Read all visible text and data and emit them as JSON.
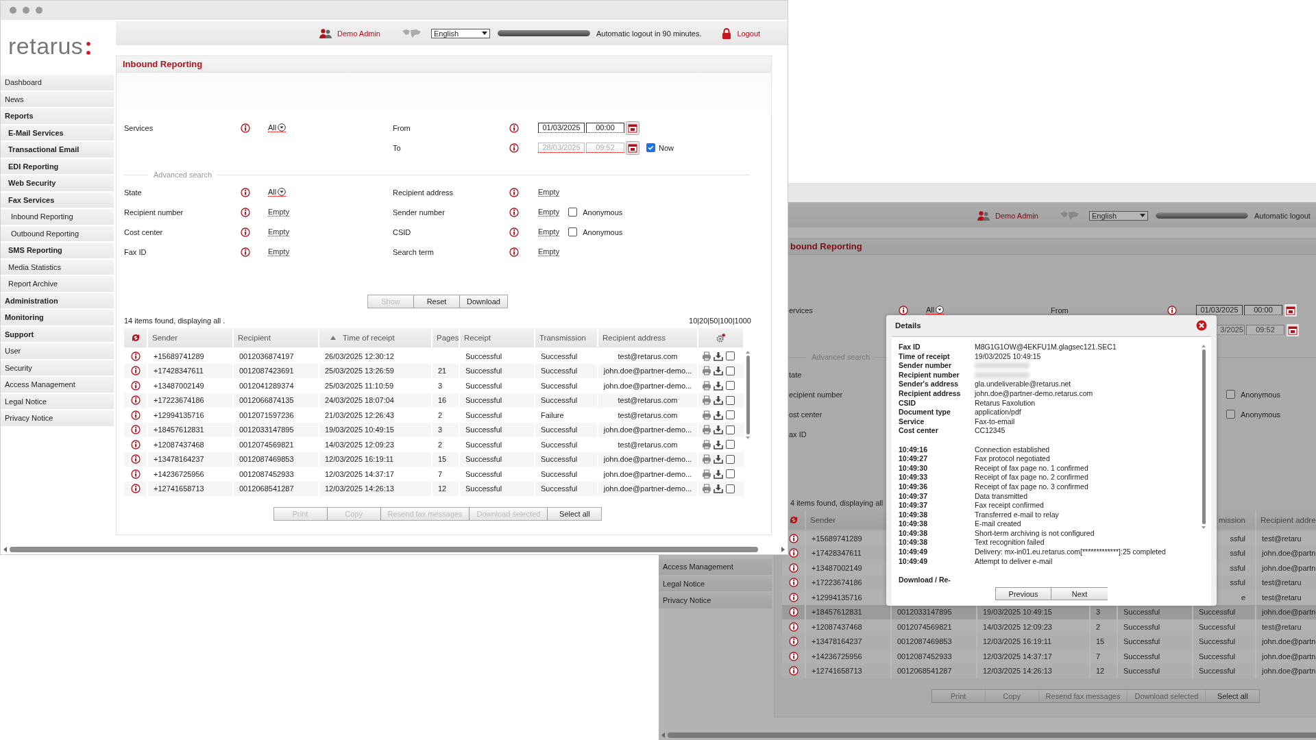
{
  "front_window": {
    "logo": "retarus",
    "header": {
      "user": "Demo Admin",
      "language": "English",
      "session_bar": {
        "level": 1
      },
      "logout_notice": "Automatic logout in 90 minutes.",
      "logout": "Logout"
    },
    "sidebar": [
      {
        "label": "Dashboard",
        "kind": "item"
      },
      {
        "label": "News",
        "kind": "item"
      },
      {
        "label": "Reports",
        "kind": "section"
      },
      {
        "label": "E-Mail Services",
        "kind": "group"
      },
      {
        "label": "Transactional Email",
        "kind": "group"
      },
      {
        "label": "EDI Reporting",
        "kind": "group"
      },
      {
        "label": "Web Security",
        "kind": "group"
      },
      {
        "label": "Fax Services",
        "kind": "group"
      },
      {
        "label": "Inbound Reporting",
        "kind": "sub"
      },
      {
        "label": "Outbound Reporting",
        "kind": "sub"
      },
      {
        "label": "SMS Reporting",
        "kind": "group"
      },
      {
        "label": "Media Statistics",
        "kind": "page"
      },
      {
        "label": "Report Archive",
        "kind": "page"
      },
      {
        "label": "Administration",
        "kind": "section"
      },
      {
        "label": "Monitoring",
        "kind": "section"
      },
      {
        "label": "Support",
        "kind": "section"
      },
      {
        "label": "User",
        "kind": "item"
      },
      {
        "label": "Security",
        "kind": "item"
      },
      {
        "label": "Access Management",
        "kind": "item"
      },
      {
        "label": "Legal Notice",
        "kind": "item"
      },
      {
        "label": "Privacy Notice",
        "kind": "item"
      }
    ],
    "page_title": "Inbound Reporting",
    "services": {
      "label": "Services",
      "value": "All"
    },
    "from": {
      "label": "From",
      "date": "01/03/2025",
      "time": "00:00",
      "disabled": false
    },
    "to": {
      "label": "To",
      "date": "28/03/2025",
      "time": "09:52",
      "disabled": true
    },
    "now": {
      "label": "Now",
      "checked": true
    },
    "advanced_title": "Advanced search",
    "fields": [
      {
        "label": "State",
        "value": "All",
        "kind": "dropdown"
      },
      {
        "label": "Recipient address",
        "value": "Empty",
        "kind": "link"
      },
      {
        "label": "Recipient number",
        "value": "Empty",
        "kind": "link"
      },
      {
        "label": "Sender number",
        "value": "Empty",
        "kind": "link",
        "anonymous": {
          "label": "Anonymous",
          "checked": false
        }
      },
      {
        "label": "Cost center",
        "value": "Empty",
        "kind": "link"
      },
      {
        "label": "CSID",
        "value": "Empty",
        "kind": "link",
        "anonymous": {
          "label": "Anonymous",
          "checked": false
        }
      },
      {
        "label": "Fax ID",
        "value": "Empty",
        "kind": "link"
      },
      {
        "label": "Search term",
        "value": "Empty",
        "kind": "link"
      }
    ],
    "buttons": [
      {
        "label": "Show",
        "disabled": true
      },
      {
        "label": "Reset",
        "disabled": false
      },
      {
        "label": "Download",
        "disabled": false
      }
    ],
    "summary": "14 items found, displaying all .",
    "page_sizes": "10|20|50|100|1000",
    "columns": [
      {
        "label": "Sender",
        "sorted": false
      },
      {
        "label": "Recipient",
        "sorted": false
      },
      {
        "label": "Time of receipt",
        "sorted": true
      },
      {
        "label": "Pages",
        "sorted": false
      },
      {
        "label": "Receipt",
        "sorted": false
      },
      {
        "label": "Transmission",
        "sorted": false
      },
      {
        "label": "Recipient address",
        "sorted": false
      }
    ],
    "rows": [
      {
        "sender": "+15689741289",
        "recipient": "0012036874197",
        "time": "26/03/2025 12:30:12",
        "receipt": "Successful",
        "transmission": "Successful",
        "address": "test@retarus.com",
        "checked": false
      },
      {
        "sender": "+17428347611",
        "recipient": "0012087423691",
        "time": "25/03/2025 13:26:59",
        "pages": "21",
        "receipt": "Successful",
        "transmission": "Successful",
        "address": "john.doe@partner-demo...",
        "checked": false
      },
      {
        "sender": "+13487002149",
        "recipient": "0012041289374",
        "time": "25/03/2025 11:10:59",
        "pages": "3",
        "receipt": "Successful",
        "transmission": "Successful",
        "address": "john.doe@partner-demo...",
        "checked": false
      },
      {
        "sender": "+17223674186",
        "recipient": "0012066874135",
        "time": "24/03/2025 18:07:04",
        "pages": "16",
        "receipt": "Successful",
        "transmission": "Successful",
        "address": "test@retarus.com",
        "checked": false
      },
      {
        "sender": "+12994135716",
        "recipient": "0012071597236",
        "time": "21/03/2025 12:26:43",
        "pages": "2",
        "receipt": "Successful",
        "transmission": "Failure",
        "address": "test@retarus.com",
        "checked": false
      },
      {
        "sender": "+18457612831",
        "recipient": "0012033147895",
        "time": "19/03/2025 10:49:15",
        "pages": "3",
        "receipt": "Successful",
        "transmission": "Successful",
        "address": "john.doe@partner-demo...",
        "checked": false
      },
      {
        "sender": "+12087437468",
        "recipient": "0012074569821",
        "time": "14/03/2025 12:09:23",
        "pages": "2",
        "receipt": "Successful",
        "transmission": "Successful",
        "address": "test@retarus.com",
        "checked": false
      },
      {
        "sender": "+13478164237",
        "recipient": "0012087469853",
        "time": "12/03/2025 16:19:11",
        "pages": "15",
        "receipt": "Successful",
        "transmission": "Successful",
        "address": "john.doe@partner-demo...",
        "checked": false
      },
      {
        "sender": "+14236725956",
        "recipient": "0012087452933",
        "time": "12/03/2025 14:37:17",
        "pages": "7",
        "receipt": "Successful",
        "transmission": "Successful",
        "address": "john.doe@partner-demo...",
        "checked": false
      },
      {
        "sender": "+12741658713",
        "recipient": "0012068541287",
        "time": "12/03/2025 14:26:13",
        "pages": "12",
        "receipt": "Successful",
        "transmission": "Successful",
        "address": "john.doe@partner-demo...",
        "checked": false
      }
    ],
    "actions": [
      {
        "label": "Print",
        "disabled": true
      },
      {
        "label": "Copy",
        "disabled": true
      },
      {
        "label": "Resend fax messages",
        "disabled": true
      },
      {
        "label": "Download selected",
        "disabled": true
      },
      {
        "label": "Select all",
        "disabled": false
      }
    ]
  },
  "back_window": {
    "header": {
      "user": "Demo Admin",
      "language": "English",
      "session_bar": {
        "level": 1
      },
      "logout_notice": "Automatic logout"
    },
    "sidebar": [
      {
        "label": "Access Management"
      },
      {
        "label": "Legal Notice"
      },
      {
        "label": "Privacy Notice"
      }
    ],
    "page_title": "bound Reporting",
    "services": {
      "label": "ervices",
      "value": "All"
    },
    "from": {
      "label": "From",
      "date": "01/03/2025",
      "time": "00:00",
      "disabled": false
    },
    "to": {
      "date": "3/2025",
      "time": "09:52",
      "disabled": true
    },
    "advanced_title": "Advanced search",
    "field_labels": [
      "tate",
      "ecipient number",
      "ost center",
      "ax ID"
    ],
    "anonymous": [
      {
        "label": "Anonymous",
        "checked": false
      },
      {
        "label": "Anonymous",
        "checked": false
      }
    ],
    "summary": "4 items found, displaying all",
    "columns": [
      {
        "label": "Sender"
      },
      {
        "label": "mission"
      },
      {
        "label": "Recipient addre"
      }
    ],
    "rows": [
      {
        "sender": "+15689741289",
        "transmission": "ssful",
        "address": "test@retaru",
        "selected": false
      },
      {
        "sender": "+17428347611",
        "transmission": "ssful",
        "address": "john.doe@partn",
        "selected": false
      },
      {
        "sender": "+13487002149",
        "transmission": "ssful",
        "address": "john.doe@partn",
        "selected": false
      },
      {
        "sender": "+17223674186",
        "transmission": "ssful",
        "address": "test@retaru",
        "selected": false
      },
      {
        "sender": "+12994135716",
        "transmission": "e",
        "address": "test@retaru",
        "selected": false
      },
      {
        "sender": "+18457612831",
        "recipient": "0012033147895",
        "time": "19/03/2025 10:49:15",
        "pages": "3",
        "receipt": "Successful",
        "transmission": "Successful",
        "address": "john.doe@partn",
        "selected": true
      },
      {
        "sender": "+12087437468",
        "recipient": "0012074569821",
        "time": "14/03/2025 12:09:23",
        "pages": "2",
        "receipt": "Successful",
        "transmission": "Successful",
        "address": "test@retaru",
        "selected": false
      },
      {
        "sender": "+13478164237",
        "recipient": "0012087469853",
        "time": "12/03/2025 16:19:11",
        "pages": "15",
        "receipt": "Successful",
        "transmission": "Successful",
        "address": "john.doe@partn",
        "selected": false
      },
      {
        "sender": "+14236725956",
        "recipient": "0012087452933",
        "time": "12/03/2025 14:37:17",
        "pages": "7",
        "receipt": "Successful",
        "transmission": "Successful",
        "address": "john.doe@partn",
        "selected": false
      },
      {
        "sender": "+12741658713",
        "recipient": "0012068541287",
        "time": "12/03/2025 14:26:13",
        "pages": "12",
        "receipt": "Successful",
        "transmission": "Successful",
        "address": "john.doe@partn",
        "selected": false
      }
    ],
    "actions": [
      {
        "label": "Print",
        "disabled": true
      },
      {
        "label": "Copy",
        "disabled": true
      },
      {
        "label": "Resend fax messages",
        "disabled": true
      },
      {
        "label": "Download selected",
        "disabled": true
      },
      {
        "label": "Select all",
        "disabled": false
      }
    ],
    "details": {
      "title": "Details",
      "fields": [
        {
          "label": "Fax ID",
          "value": "M8G1G1OW@4EKFU1M.glagsec121.SEC1"
        },
        {
          "label": "Time of receipt",
          "value": "19/03/2025 10:49:15"
        },
        {
          "label": "Sender number",
          "redacted": true
        },
        {
          "label": "Recipient number",
          "redacted": true
        },
        {
          "label": "Sender's address",
          "value": "gla.undeliverable@retarus.net"
        },
        {
          "label": "Recipient address",
          "value": "john.doe@partner-demo.retarus.com"
        },
        {
          "label": "CSID",
          "value": "Retarus Faxolution"
        },
        {
          "label": "Document type",
          "value": "application/pdf"
        },
        {
          "label": "Service",
          "value": "Fax-to-email"
        },
        {
          "label": "Cost center",
          "value": "CC12345"
        }
      ],
      "events": [
        {
          "time": "10:49:16",
          "text": "Connection established"
        },
        {
          "time": "10:49:27",
          "text": "Fax protocol negotiated"
        },
        {
          "time": "10:49:30",
          "text": "Receipt of fax page no. 1 confirmed"
        },
        {
          "time": "10:49:33",
          "text": "Receipt of fax page no. 2 confirmed"
        },
        {
          "time": "10:49:36",
          "text": "Receipt of fax page no. 3 confirmed"
        },
        {
          "time": "10:49:37",
          "text": "Data transmitted"
        },
        {
          "time": "10:49:37",
          "text": "Fax receipt confirmed"
        },
        {
          "time": "10:49:38",
          "text": "Transferred e-mail to relay"
        },
        {
          "time": "10:49:38",
          "text": "E-mail created"
        },
        {
          "time": "10:49:38",
          "text": "Short-term archiving is not configured"
        },
        {
          "time": "10:49:38",
          "text": "Text recognition failed"
        },
        {
          "time": "10:49:49",
          "text": "Delivery: mx-in01.eu.retarus.com[*************]:25 completed"
        },
        {
          "time": "10:49:49",
          "text": "Attempt to deliver e-mail"
        }
      ],
      "section": "Download / Re-",
      "buttons": [
        {
          "label": "Previous"
        },
        {
          "label": "Next"
        }
      ]
    }
  }
}
